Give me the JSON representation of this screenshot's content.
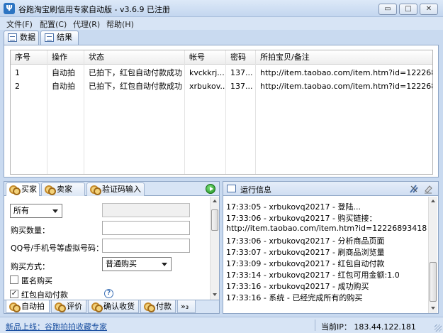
{
  "window": {
    "title": "谷跑淘宝刷信用专家自动版 - v3.6.9 已注册",
    "app_icon_glyph": "Ψ",
    "min_glyph": "▭",
    "max_glyph": "□",
    "close_glyph": "✕"
  },
  "menu": {
    "items": [
      "文件(F)",
      "配置(C)",
      "代理(R)",
      "帮助(H)"
    ]
  },
  "top_tabs": [
    {
      "label": "数据",
      "active": false
    },
    {
      "label": "结果",
      "active": true
    }
  ],
  "results_table": {
    "columns": [
      "序号",
      "操作",
      "状态",
      "帐号",
      "密码",
      "所拍宝贝/备注"
    ],
    "rows": [
      [
        "1",
        "自动拍",
        "已拍下，红包自动付款成功",
        "kvckkrj...",
        "137...",
        "http://item.taobao.com/item.htm?id=122268..."
      ],
      [
        "2",
        "自动拍",
        "已拍下，红包自动付款成功",
        "xrbukov...",
        "137...",
        "http://item.taobao.com/item.htm?id=122268..."
      ]
    ]
  },
  "left_panel": {
    "tabs": [
      {
        "label": "买家",
        "active": true
      },
      {
        "label": "卖家",
        "active": false
      },
      {
        "label": "验证码输入",
        "active": false
      }
    ],
    "form": {
      "scope_select": "所有",
      "quantity_label": "购买数量：",
      "qq_label": "QQ号/手机号等虚拟号码：",
      "buy_mode_label": "购买方式：",
      "buy_mode_select": "普通购买",
      "anonymous_label": "匿名购买",
      "anonymous_checked": false,
      "redpacket_label": "红包自动付款",
      "redpacket_checked": true,
      "check_glyph": "✓",
      "help_glyph": "?"
    },
    "bottom_tabs": [
      {
        "label": "自动拍",
        "active": true
      },
      {
        "label": "评价",
        "active": false
      },
      {
        "label": "确认收货",
        "active": false
      },
      {
        "label": "付款",
        "active": false
      }
    ],
    "more_tabs_label": "»₃"
  },
  "right_panel": {
    "title": "运行信息",
    "log": [
      "17:33:05 - xrbukovq20217 - 登陆...",
      "17:33:06 - xrbukovq20217 - 购买链接：",
      "http://item.taobao.com/item.htm?id=12226893418",
      "17:33:06 - xrbukovq20217 - 分析商品页面",
      "17:33:07 - xrbukovq20217 - 刷商品浏览量",
      "17:33:09 - xrbukovq20217 - 红包自动付款",
      "17:33:14 - xrbukovq20217 - 红包可用金额:1.0",
      "17:33:16 - xrbukovq20217 - 成功购买",
      "17:33:16 - 系统 - 已经完成所有的购买"
    ]
  },
  "status_bar": {
    "link": "新品上线：谷跑拍拍收藏专家",
    "ip": "当前IP： 183.44.122.181"
  }
}
